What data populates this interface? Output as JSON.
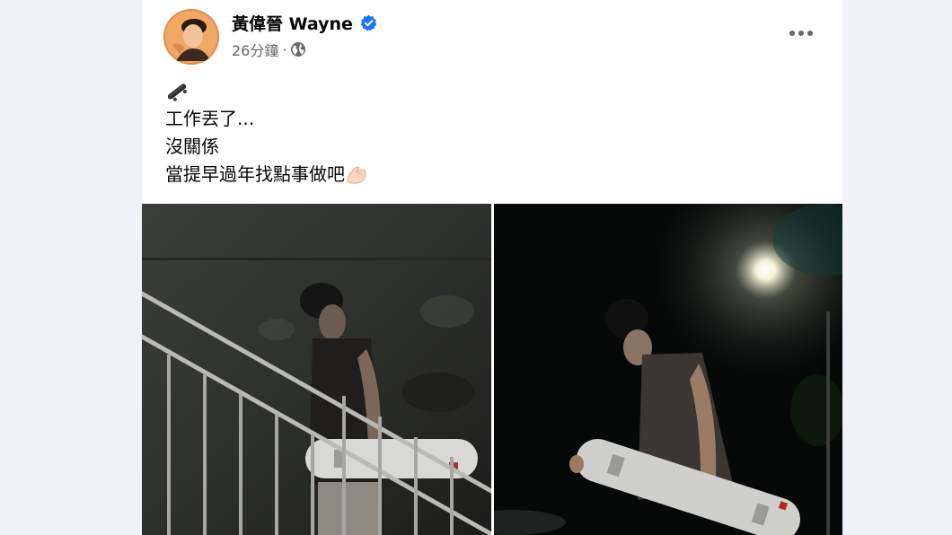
{
  "post": {
    "author": {
      "name": "黃偉晉 Wayne",
      "verified": true
    },
    "timestamp": "26分鐘",
    "separator": "·",
    "audience_icon": "globe-icon",
    "more_icon": "more-options-icon",
    "text_lines": [
      {
        "emoji": "skateboard-icon"
      },
      {
        "text": "工作丟了..."
      },
      {
        "text": "沒關係"
      },
      {
        "text": "當提早過年找點事做吧",
        "emoji": "flexed-biceps-icon"
      }
    ],
    "photos": [
      {
        "name": "photo-stairs-skateboard"
      },
      {
        "name": "photo-streetlight-skateboard"
      }
    ]
  },
  "colors": {
    "page_bg": "#f0f2f5",
    "card_bg": "#ffffff",
    "text_primary": "#050505",
    "text_secondary": "#65676b",
    "verified_blue": "#1877f2"
  }
}
